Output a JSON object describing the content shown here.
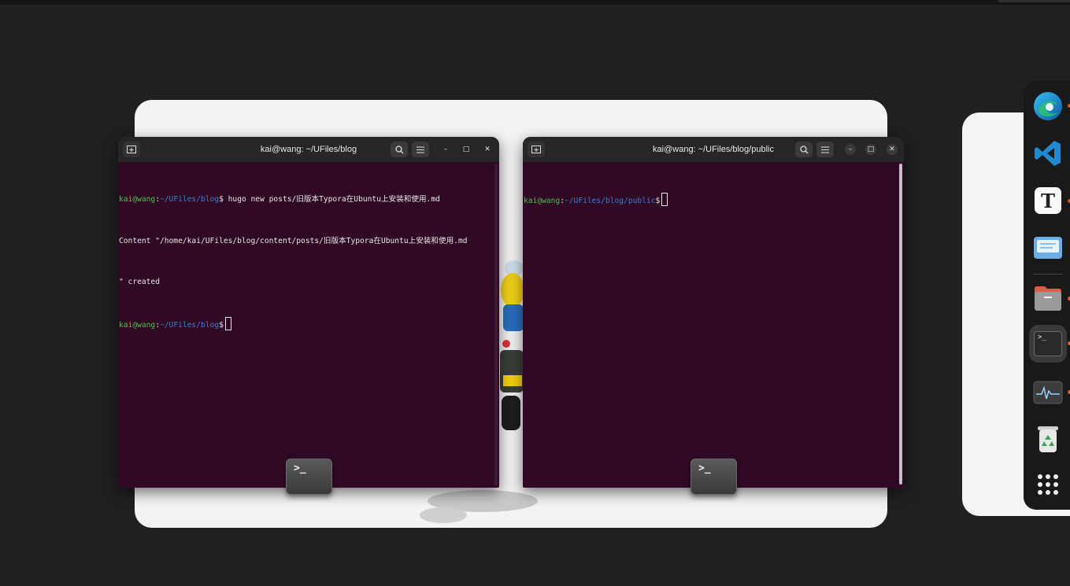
{
  "terminal_left": {
    "title": "kai@wang: ~/UFiles/blog",
    "lines": [
      {
        "user": "kai@wang",
        "sep": ":",
        "path": "~/UFiles/blog",
        "dollar": "$",
        "text": " hugo new posts/旧版本Typora在Ubuntu上安装和使用.md"
      },
      {
        "text": "Content \"/home/kai/UFiles/blog/content/posts/旧版本Typora在Ubuntu上安装和使用.md"
      },
      {
        "text": "\" created"
      },
      {
        "user": "kai@wang",
        "sep": ":",
        "path": "~/UFiles/blog",
        "dollar": "$",
        "text": " "
      }
    ],
    "overlay_icon": "terminal-app-icon"
  },
  "terminal_right": {
    "title": "kai@wang: ~/UFiles/blog/public",
    "lines": [
      {
        "user": "kai@wang",
        "sep": ":",
        "path": "~/UFiles/blog/public",
        "dollar": "$",
        "text": " "
      }
    ],
    "overlay_icon": "terminal-app-icon"
  },
  "overlay_glyph": ">_",
  "headerbar_icons": {
    "new_tab": "new-tab-icon",
    "search": "search-icon",
    "menu": "hamburger-menu-icon",
    "minimize": "–",
    "maximize": "□",
    "close": "✕"
  },
  "dock": {
    "items": [
      {
        "name": "edge",
        "icon": "microsoft-edge-icon",
        "running": true
      },
      {
        "name": "vscode",
        "icon": "vscode-icon",
        "running": false
      },
      {
        "name": "typora",
        "icon": "typora-icon",
        "label": "T",
        "running": true
      },
      {
        "name": "mail",
        "icon": "mail-icon",
        "running": false
      },
      {
        "name": "files",
        "icon": "files-icon",
        "running": true
      },
      {
        "name": "terminal",
        "icon": "terminal-icon",
        "label": ">_",
        "running": true,
        "active": true
      },
      {
        "name": "system-monitor",
        "icon": "system-monitor-icon",
        "running": true
      },
      {
        "name": "trash",
        "icon": "trash-icon",
        "running": false
      },
      {
        "name": "show-apps",
        "icon": "app-grid-icon",
        "running": false
      }
    ]
  },
  "colors": {
    "terminal_bg": "#300a24",
    "prompt_user": "#4fbf4f",
    "prompt_path": "#3a7bd5",
    "accent": "#e95420"
  }
}
